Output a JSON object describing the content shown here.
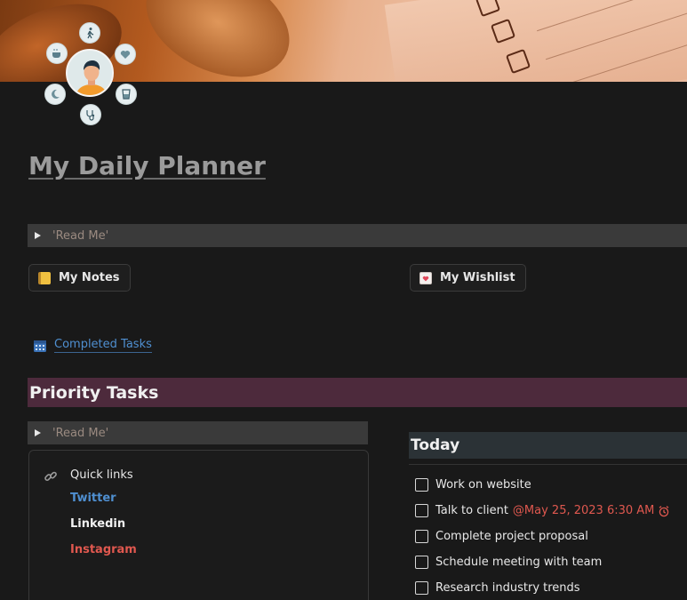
{
  "page": {
    "title": "My Daily Planner"
  },
  "toggles": [
    {
      "label": "'Read Me'"
    },
    {
      "label": "'Read Me'"
    }
  ],
  "buttons": {
    "notes_label": "My Notes",
    "wishlist_label": "My Wishlist"
  },
  "completed_link": {
    "label": "Completed Tasks",
    "icon": "calendar-icon"
  },
  "priority": {
    "heading": "Priority Tasks"
  },
  "quick_links": {
    "title": "Quick links",
    "icon": "link-chain-icon",
    "links": [
      {
        "label": "Twitter",
        "color": "#4f8fd0"
      },
      {
        "label": "Linkedin",
        "color": "#f2f2f2"
      },
      {
        "label": "Instagram",
        "color": "#e0584f"
      }
    ]
  },
  "today": {
    "heading": "Today",
    "tasks": [
      {
        "label": "Work on website",
        "checked": false
      },
      {
        "label": "Talk to client",
        "mention": "@May 25, 2023 6:30 AM",
        "reminder_icon": "alarm-clock-icon",
        "checked": false
      },
      {
        "label": "Complete project proposal",
        "checked": false
      },
      {
        "label": "Schedule meeting with team",
        "checked": false
      },
      {
        "label": "Research industry trends",
        "checked": false
      }
    ]
  },
  "colors": {
    "background": "#191919",
    "priority_band": "#4d2a3c",
    "today_band": "#2b3236",
    "link_blue": "#4f8fd0",
    "mention_red": "#e0584f"
  }
}
